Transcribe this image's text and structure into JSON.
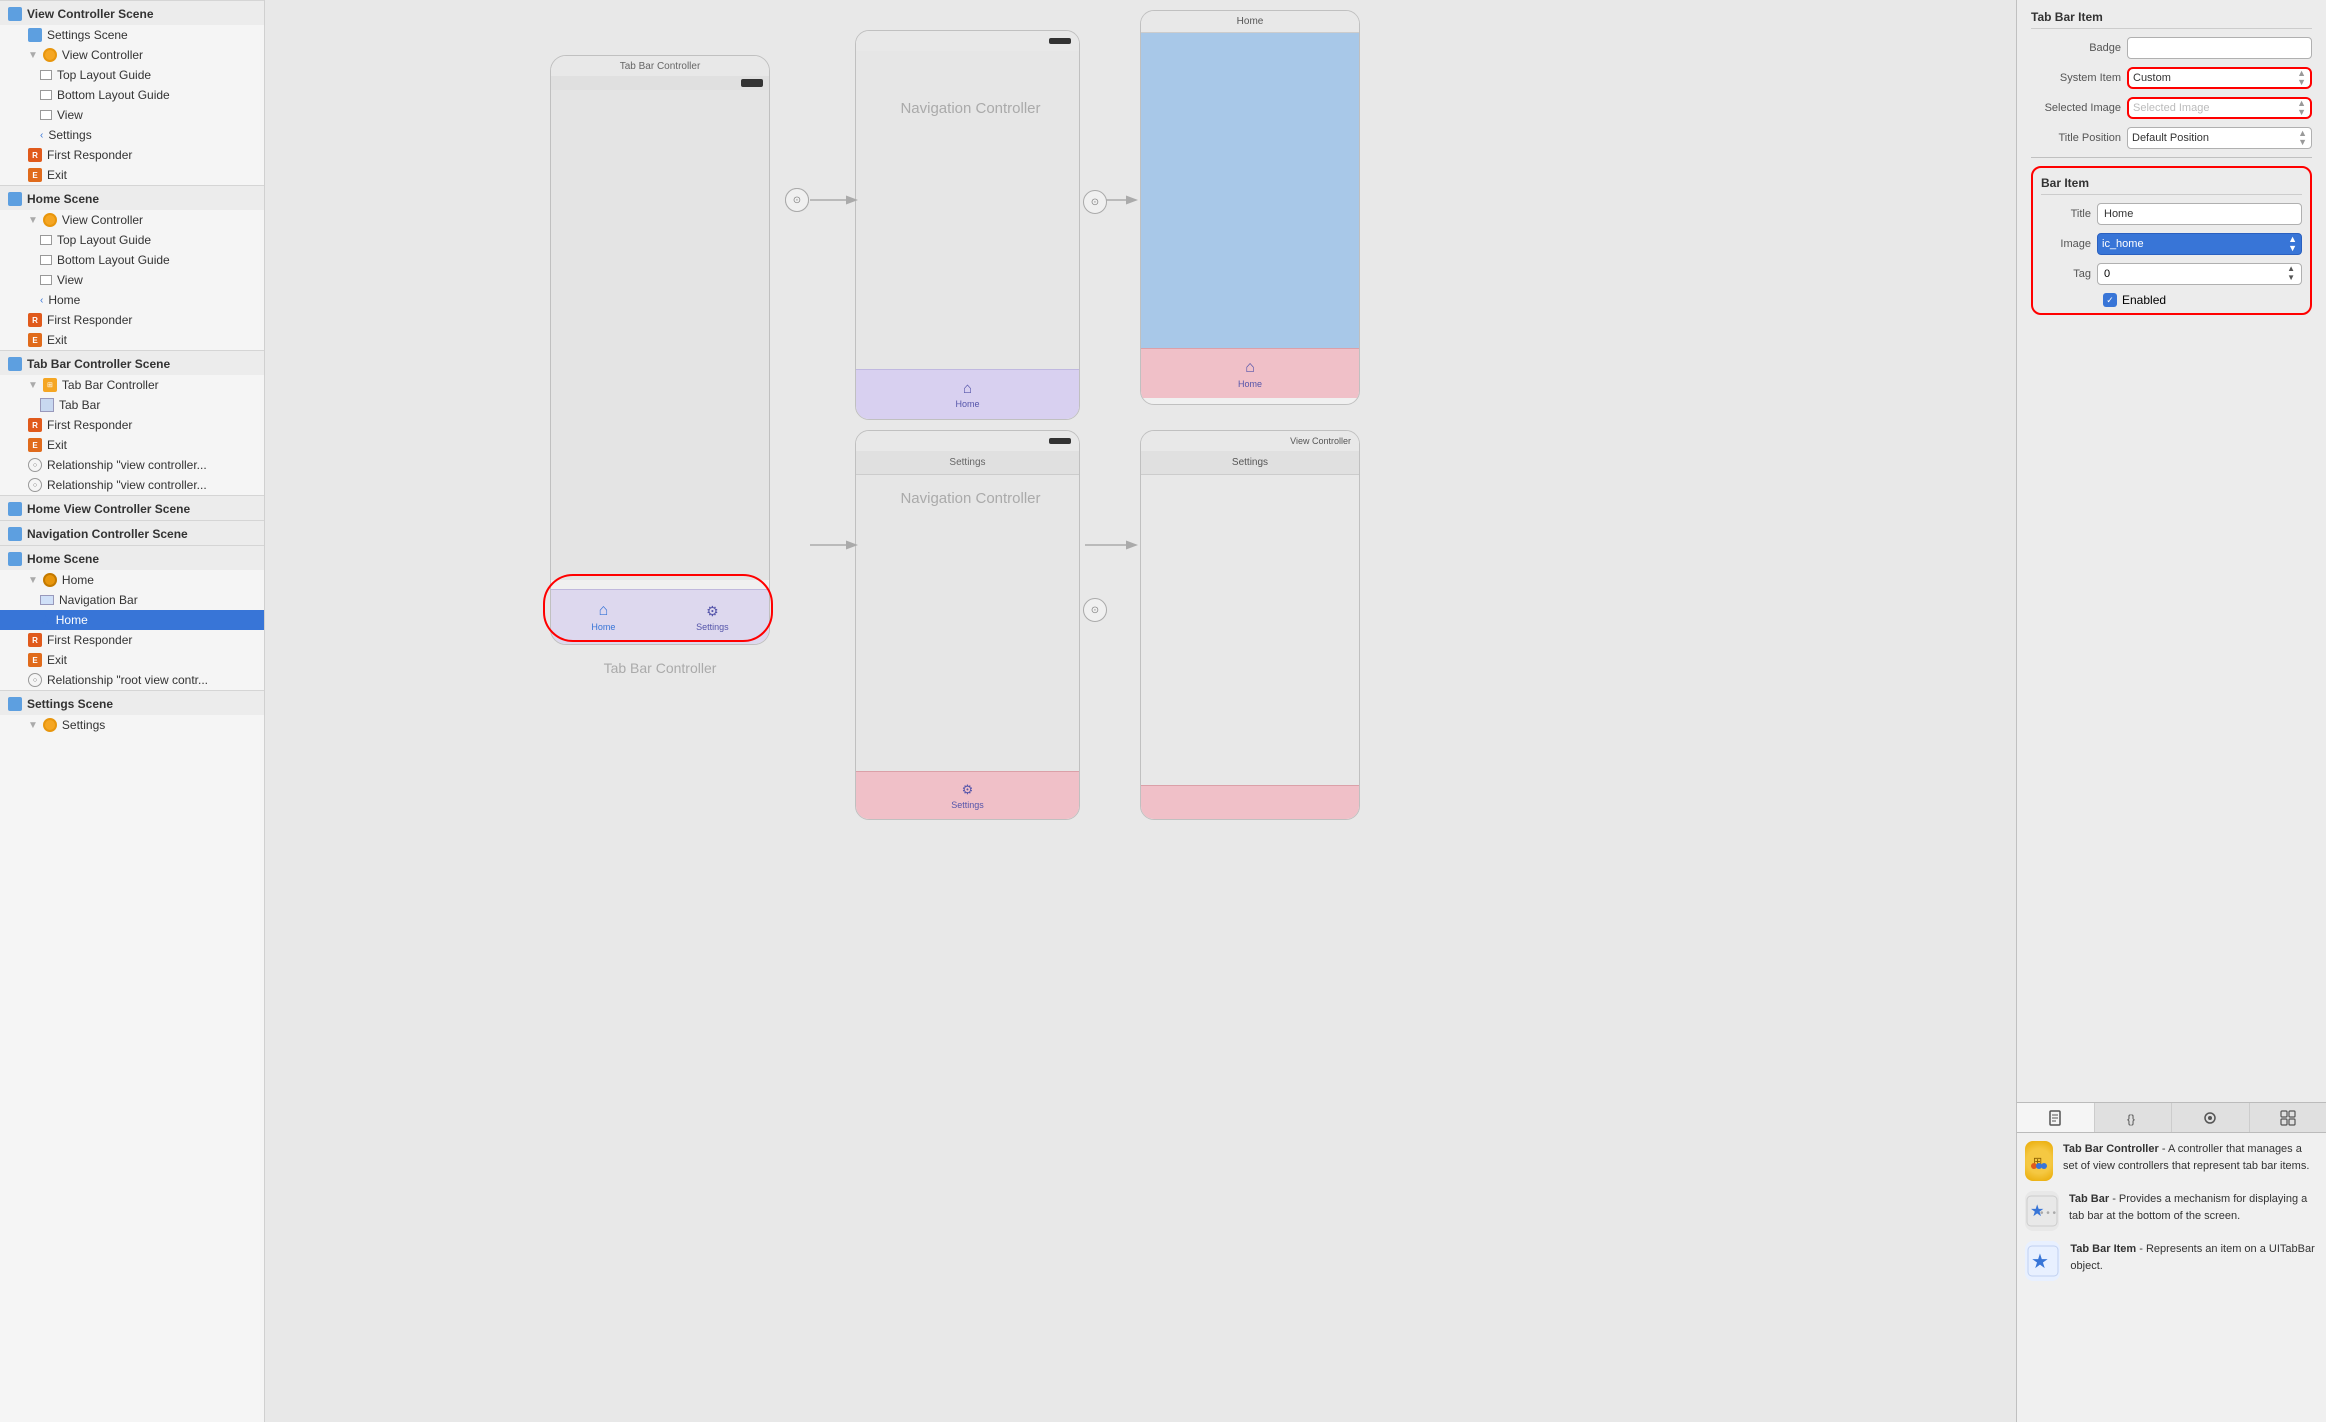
{
  "sidebar": {
    "sections": [
      {
        "title": "View Controller Scene",
        "icon": "grid",
        "items": [
          {
            "label": "Settings Scene",
            "indent": 1,
            "icon": "grid"
          },
          {
            "label": "View Controller",
            "indent": 1,
            "icon": "yellow-circle",
            "expandable": true
          },
          {
            "label": "Top Layout Guide",
            "indent": 2,
            "icon": "rect"
          },
          {
            "label": "Bottom Layout Guide",
            "indent": 2,
            "icon": "rect"
          },
          {
            "label": "View",
            "indent": 2,
            "icon": "rect"
          },
          {
            "label": "Settings",
            "indent": 2,
            "icon": "chevron"
          },
          {
            "label": "First Responder",
            "indent": 1,
            "icon": "responder"
          },
          {
            "label": "Exit",
            "indent": 1,
            "icon": "exit"
          }
        ]
      },
      {
        "title": "Home Scene",
        "icon": "grid",
        "items": [
          {
            "label": "View Controller",
            "indent": 1,
            "icon": "yellow-circle",
            "expandable": true
          },
          {
            "label": "Top Layout Guide",
            "indent": 2,
            "icon": "rect"
          },
          {
            "label": "Bottom Layout Guide",
            "indent": 2,
            "icon": "rect"
          },
          {
            "label": "View",
            "indent": 2,
            "icon": "rect"
          },
          {
            "label": "Home",
            "indent": 2,
            "icon": "chevron"
          },
          {
            "label": "First Responder",
            "indent": 1,
            "icon": "responder"
          },
          {
            "label": "Exit",
            "indent": 1,
            "icon": "exit"
          }
        ]
      },
      {
        "title": "Tab Bar Controller Scene",
        "icon": "grid",
        "items": [
          {
            "label": "Tab Bar Controller",
            "indent": 1,
            "icon": "tab-bar-ctrl",
            "expandable": true
          },
          {
            "label": "Tab Bar",
            "indent": 2,
            "icon": "tab-bar"
          },
          {
            "label": "First Responder",
            "indent": 1,
            "icon": "responder"
          },
          {
            "label": "Exit",
            "indent": 1,
            "icon": "exit"
          },
          {
            "label": "Relationship \"view controller...",
            "indent": 1,
            "icon": "relationship"
          },
          {
            "label": "Relationship \"view controller...",
            "indent": 1,
            "icon": "relationship"
          }
        ]
      },
      {
        "title": "Home View Controller Scene",
        "icon": "grid"
      },
      {
        "title": "Navigation Controller Scene",
        "icon": "grid"
      },
      {
        "title": "Home Scene",
        "icon": "grid",
        "items": [
          {
            "label": "Home",
            "indent": 1,
            "icon": "orange-circle",
            "expandable": true
          },
          {
            "label": "Navigation Bar",
            "indent": 2,
            "icon": "nav-bar"
          },
          {
            "label": "Home",
            "indent": 2,
            "icon": "star",
            "selected": true
          },
          {
            "label": "First Responder",
            "indent": 1,
            "icon": "responder"
          },
          {
            "label": "Exit",
            "indent": 1,
            "icon": "exit"
          },
          {
            "label": "Relationship \"root view contr...",
            "indent": 1,
            "icon": "relationship"
          }
        ]
      },
      {
        "title": "Settings Scene",
        "icon": "grid",
        "items": [
          {
            "label": "Settings",
            "indent": 1,
            "icon": "orange-circle-partial",
            "expandable": true
          }
        ]
      }
    ]
  },
  "canvas": {
    "tab_bar_controller_label": "Tab Bar Controller",
    "navigation_controller_label": "Navigation Controller",
    "home_phone": {
      "nav_bar_title": "Home"
    },
    "settings_phone": {
      "title": "Settings"
    },
    "view_controller_phone": {
      "title": "View Controller",
      "settings_label": "Settings"
    }
  },
  "right_panel": {
    "tab_bar_item_title": "Tab Bar Item",
    "badge_label": "Badge",
    "system_item_label": "System Item",
    "system_item_value": "Custom",
    "selected_image_label": "Selected Image",
    "selected_image_placeholder": "Selected Image",
    "title_position_label": "Title Position",
    "title_position_value": "Default Position",
    "bar_item_title": "Bar Item",
    "title_label": "Title",
    "title_value": "Home",
    "image_label": "Image",
    "image_value": "ic_home",
    "tag_label": "Tag",
    "tag_value": "0",
    "enabled_label": "Enabled"
  },
  "library": {
    "tabs": [
      "file-icon",
      "curly-icon",
      "circle-icon",
      "grid-icon"
    ],
    "items": [
      {
        "icon": "tab-bar-controller",
        "title": "Tab Bar Controller",
        "description": "A controller that manages a set of view controllers that represent tab bar items."
      },
      {
        "icon": "tab-bar",
        "title": "Tab Bar",
        "description": "Provides a mechanism for displaying a tab bar at the bottom of the screen."
      },
      {
        "icon": "tab-bar-item",
        "title": "Tab Bar Item",
        "description": "Represents an item on a UITabBar object."
      }
    ]
  }
}
